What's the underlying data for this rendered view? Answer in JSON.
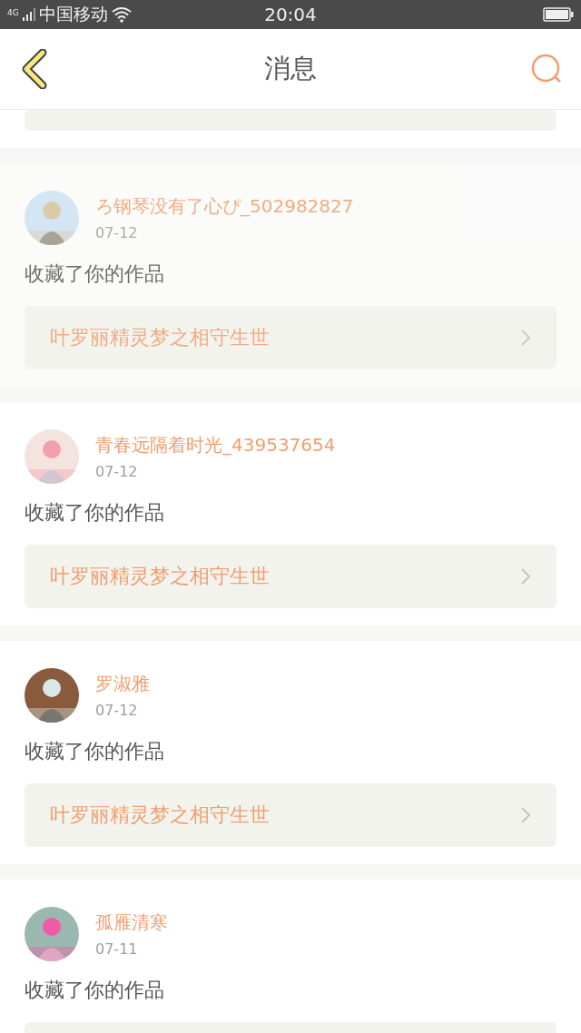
{
  "status_bar": {
    "carrier": "中国移动",
    "network": "4G",
    "time": "20:04"
  },
  "header": {
    "title": "消息"
  },
  "messages": [
    {
      "user": "ろ钢琴没有了心ぴ_502982827",
      "date": "07-12",
      "text": "收藏了你的作品",
      "work": "叶罗丽精灵梦之相守生世",
      "pressed": true
    },
    {
      "user": "青春远隔着时光_439537654",
      "date": "07-12",
      "text": "收藏了你的作品",
      "work": "叶罗丽精灵梦之相守生世",
      "pressed": false
    },
    {
      "user": "罗淑雅",
      "date": "07-12",
      "text": "收藏了你的作品",
      "work": "叶罗丽精灵梦之相守生世",
      "pressed": false
    },
    {
      "user": "孤雁清寒",
      "date": "07-11",
      "text": "收藏了你的作品",
      "pressed": false
    }
  ]
}
